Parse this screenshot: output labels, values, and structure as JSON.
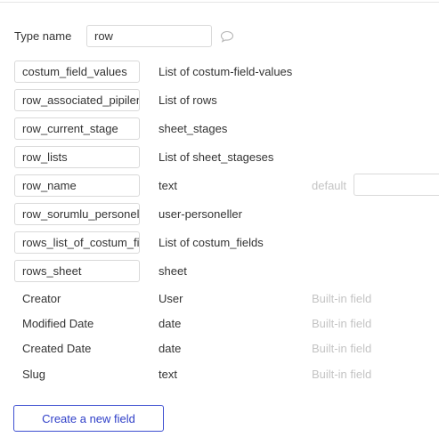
{
  "type_name": {
    "label": "Type name",
    "value": "row"
  },
  "fields": [
    {
      "name": "costum_field_values",
      "type": "List of costum-field-values"
    },
    {
      "name": "row_associated_pipilene",
      "type": "List of rows"
    },
    {
      "name": "row_current_stage",
      "type": "sheet_stages"
    },
    {
      "name": "row_lists",
      "type": "List of sheet_stageses"
    },
    {
      "name": "row_name",
      "type": "text",
      "default_label": "default",
      "default_value": ""
    },
    {
      "name": "row_sorumlu_personel",
      "type": "user-personeller"
    },
    {
      "name": "rows_list_of_costum_fields",
      "type": "List of costum_fields"
    },
    {
      "name": "rows_sheet",
      "type": "sheet"
    }
  ],
  "builtin_fields": [
    {
      "name": "Creator",
      "type": "User",
      "note": "Built-in field"
    },
    {
      "name": "Modified Date",
      "type": "date",
      "note": "Built-in field"
    },
    {
      "name": "Created Date",
      "type": "date",
      "note": "Built-in field"
    },
    {
      "name": "Slug",
      "type": "text",
      "note": "Built-in field"
    }
  ],
  "create_button_label": "Create a new field",
  "icons": {
    "comment": "comment-icon"
  },
  "colors": {
    "button_border": "#3d4fd1",
    "button_text": "#2f3fc8",
    "builtin_text": "#c4c4c4"
  }
}
